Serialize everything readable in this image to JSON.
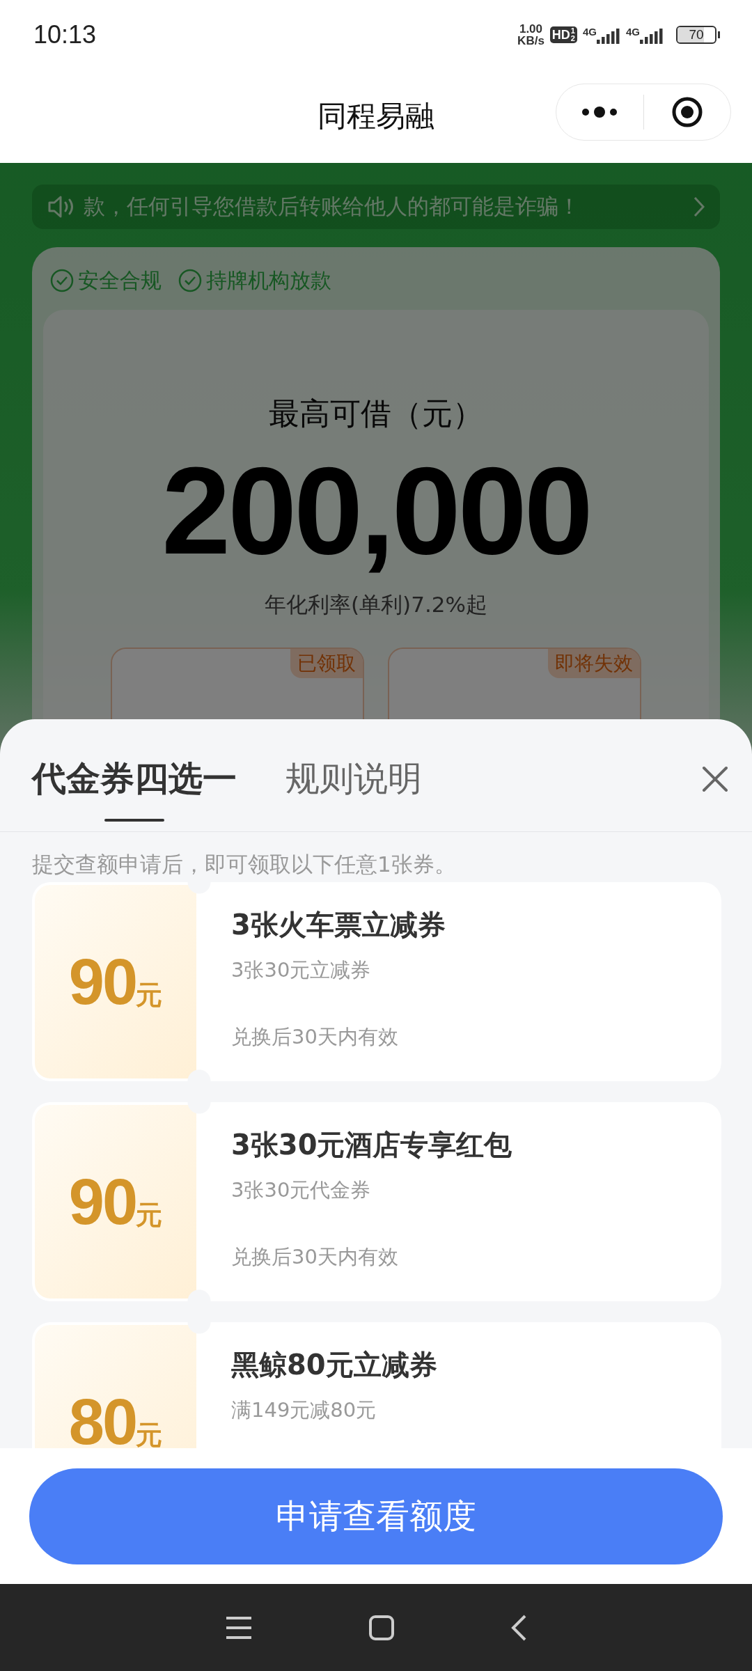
{
  "status_bar": {
    "time": "10:13",
    "net_speed": [
      "1.00",
      "KB/s"
    ],
    "hd": {
      "label": "HD",
      "slots": [
        "1",
        "2"
      ]
    },
    "signals": [
      {
        "label": "4G"
      },
      {
        "label": "4G"
      }
    ],
    "battery": {
      "label": "70",
      "level": 0.7
    }
  },
  "header": {
    "title": "同程易融"
  },
  "background": {
    "notice": "款，任何引导您借款后转账给他人的都可能是诈骗！",
    "badges": [
      "安全合规",
      "持牌机构放款"
    ],
    "limit_label": "最高可借（元）",
    "limit_amount": "200,000",
    "rate": "年化利率(单利)7.2%起",
    "tiles": [
      {
        "tag": "已领取"
      },
      {
        "tag": "即将失效"
      }
    ]
  },
  "sheet": {
    "tabs": [
      {
        "label": "代金券四选一",
        "selected": true
      },
      {
        "label": "规则说明",
        "selected": false
      }
    ],
    "hint": "提交查额申请后，即可领取以下任意1张券。",
    "coupons": [
      {
        "amount": "90",
        "unit": "元",
        "title": "3张火车票立减券",
        "detail": "3张30元立减券",
        "validity": "兑换后30天内有效"
      },
      {
        "amount": "90",
        "unit": "元",
        "title": "3张30元酒店专享红包",
        "detail": "3张30元代金券",
        "validity": "兑换后30天内有效"
      },
      {
        "amount": "80",
        "unit": "元",
        "title": "黑鲸80元立减券",
        "detail": "满149元减80元"
      }
    ]
  },
  "button": {
    "label": "申请查看额度"
  }
}
